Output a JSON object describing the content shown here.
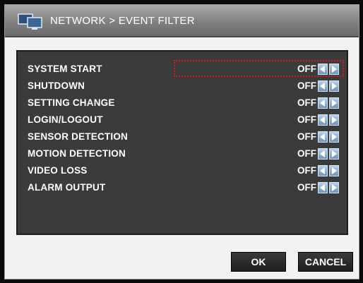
{
  "window": {
    "title": "NETWORK > EVENT FILTER",
    "icon": "network-monitors-icon"
  },
  "events": [
    {
      "label": "SYSTEM START",
      "value": "OFF"
    },
    {
      "label": "SHUTDOWN",
      "value": "OFF"
    },
    {
      "label": "SETTING CHANGE",
      "value": "OFF"
    },
    {
      "label": "LOGIN/LOGOUT",
      "value": "OFF"
    },
    {
      "label": "SENSOR DETECTION",
      "value": "OFF"
    },
    {
      "label": "MOTION DETECTION",
      "value": "OFF"
    },
    {
      "label": "VIDEO LOSS",
      "value": "OFF"
    },
    {
      "label": "ALARM OUTPUT",
      "value": "OFF"
    }
  ],
  "buttons": {
    "ok_label": "OK",
    "cancel_label": "CANCEL"
  },
  "colors": {
    "panel": "#3b3b3b",
    "focus": "#d21b1b",
    "arrow": "#8fb2d3"
  }
}
